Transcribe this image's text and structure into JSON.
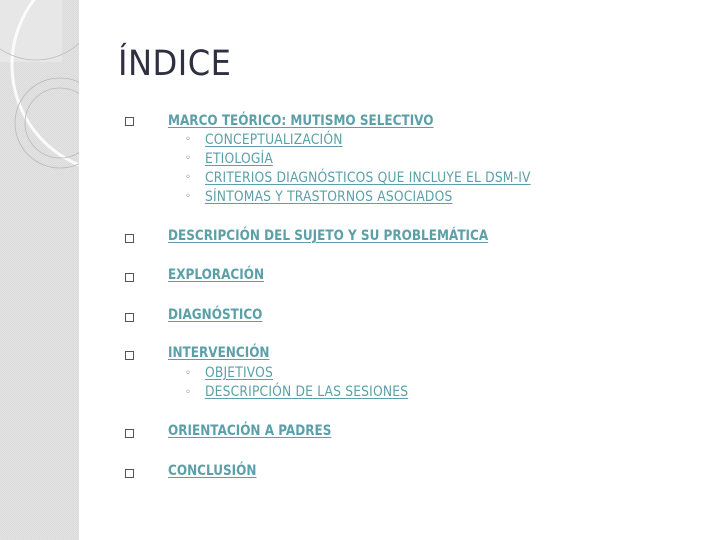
{
  "slide": {
    "title": "ÍNDICE",
    "link_color": "#5ba0a8",
    "items": [
      {
        "label": "MARCO TEÓRICO: MUTISMO SELECTIVO",
        "subitems": [
          "CONCEPTUALIZACIÓN",
          "ETIOLOGÍA",
          "CRITERIOS DIAGNÓSTICOS QUE INCLUYE EL DSM-IV",
          "SÍNTOMAS Y TRASTORNOS ASOCIADOS"
        ]
      },
      {
        "label": "DESCRIPCIÓN DEL SUJETO Y SU PROBLEMÁTICA",
        "subitems": []
      },
      {
        "label": "EXPLORACIÓN",
        "subitems": []
      },
      {
        "label": "DIAGNÓSTICO",
        "subitems": []
      },
      {
        "label": "INTERVENCIÓN",
        "subitems": [
          "OBJETIVOS",
          "DESCRIPCIÓN DE LAS SESIONES"
        ]
      },
      {
        "label": "ORIENTACIÓN A PADRES",
        "subitems": []
      },
      {
        "label": "CONCLUSIÓN",
        "subitems": []
      }
    ],
    "icons": {
      "item_bullet": "square-outline-icon",
      "sub_bullet": "circle-outline-icon"
    }
  }
}
